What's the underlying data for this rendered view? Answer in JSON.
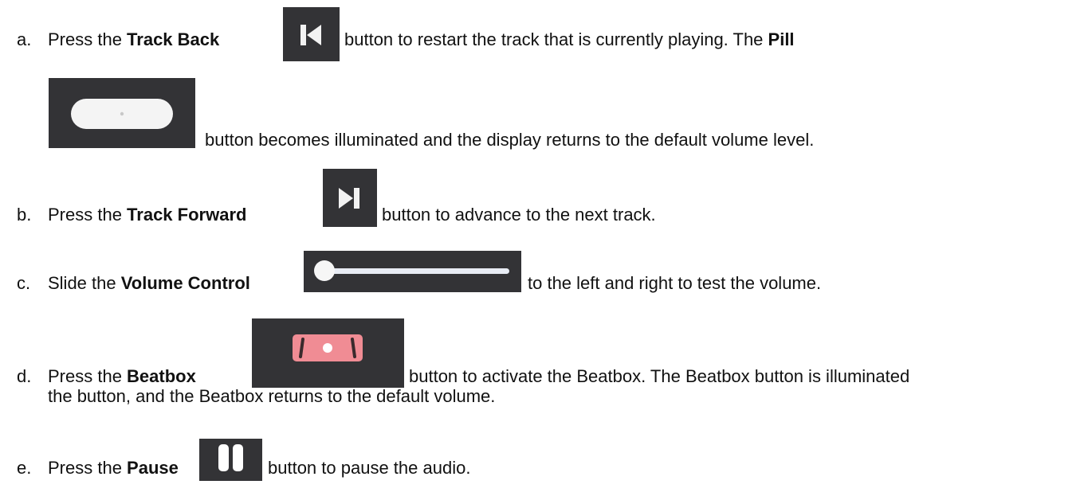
{
  "steps": [
    {
      "marker": "a.",
      "parts": [
        "Press the ",
        "Track Back",
        " button to restart the track that is currently playing. The ",
        "Pill",
        "button becomes illuminated and the display returns to the default volume level."
      ],
      "icons": [
        "track-back-icon",
        "pill-icon"
      ]
    },
    {
      "marker": "b.",
      "parts": [
        "Press the ",
        "Track Forward",
        " button to advance to the next track."
      ],
      "icons": [
        "track-forward-icon"
      ]
    },
    {
      "marker": "c.",
      "parts": [
        "Slide the ",
        "Volume Control",
        " to the left and right to test the volume."
      ],
      "icons": [
        "volume-slider-icon"
      ]
    },
    {
      "marker": "d.",
      "parts": [
        "Press the ",
        "Beatbox",
        " button to activate the Beatbox. The Beatbox button is illuminated",
        "the button, and the Beatbox returns to the default volume."
      ],
      "icons": [
        "beatbox-icon"
      ]
    },
    {
      "marker": "e.",
      "parts": [
        "Press the ",
        "Pause",
        " button to pause the audio."
      ],
      "icons": [
        "pause-icon"
      ]
    }
  ],
  "colors": {
    "text": "#111111",
    "icon_bg": "#333336",
    "pill": "#f4f4f4",
    "beatbox": "#f08c94"
  }
}
